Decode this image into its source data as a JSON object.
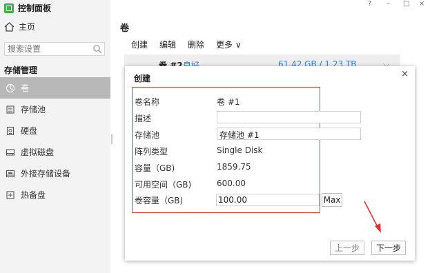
{
  "app": {
    "title": "控制面板",
    "home_label": "主页",
    "search_placeholder": "搜索设置"
  },
  "window_controls": {
    "help": "?",
    "minimize": "–",
    "maximize": "□",
    "close": "×"
  },
  "sidebar": {
    "section_title": "存储管理",
    "items": [
      {
        "label": "卷",
        "icon": "pie-icon",
        "active": true
      },
      {
        "label": "存储池",
        "icon": "storage-pool-icon"
      },
      {
        "label": "硬盘",
        "icon": "hard-disk-icon"
      },
      {
        "label": "虚拟磁盘",
        "icon": "virtual-disk-icon"
      },
      {
        "label": "外接存储设备",
        "icon": "external-storage-icon"
      },
      {
        "label": "热备盘",
        "icon": "hot-spare-icon"
      }
    ]
  },
  "main": {
    "title": "卷",
    "toolbar": {
      "create": "创建",
      "edit": "编辑",
      "delete": "删除",
      "more": "更多 ∨"
    },
    "volume_row": {
      "name": "卷 #2",
      "status": "良好",
      "size": "61.42 GB / 1.23 TB"
    }
  },
  "dialog": {
    "title": "创建",
    "close": "×",
    "fields": {
      "volume_name_label": "卷名称",
      "volume_name_value": "卷 #1",
      "description_label": "描述",
      "description_value": "",
      "storage_pool_label": "存储池",
      "storage_pool_value": "存储池 #1",
      "raid_type_label": "阵列类型",
      "raid_type_value": "Single Disk",
      "capacity_label": "容量（GB)",
      "capacity_value": "1859.75",
      "free_space_label": "可用空间（GB)",
      "free_space_value": "600.00",
      "volume_capacity_label": "卷容量（GB)",
      "volume_capacity_value": "100.00"
    },
    "max_label": "Max",
    "prev_label": "上一步",
    "next_label": "下一步"
  },
  "colors": {
    "highlight_box": "#d53b3b",
    "active_nav": "#b8b8b8",
    "link": "#3a7bd5",
    "arrow": "#e03030"
  }
}
